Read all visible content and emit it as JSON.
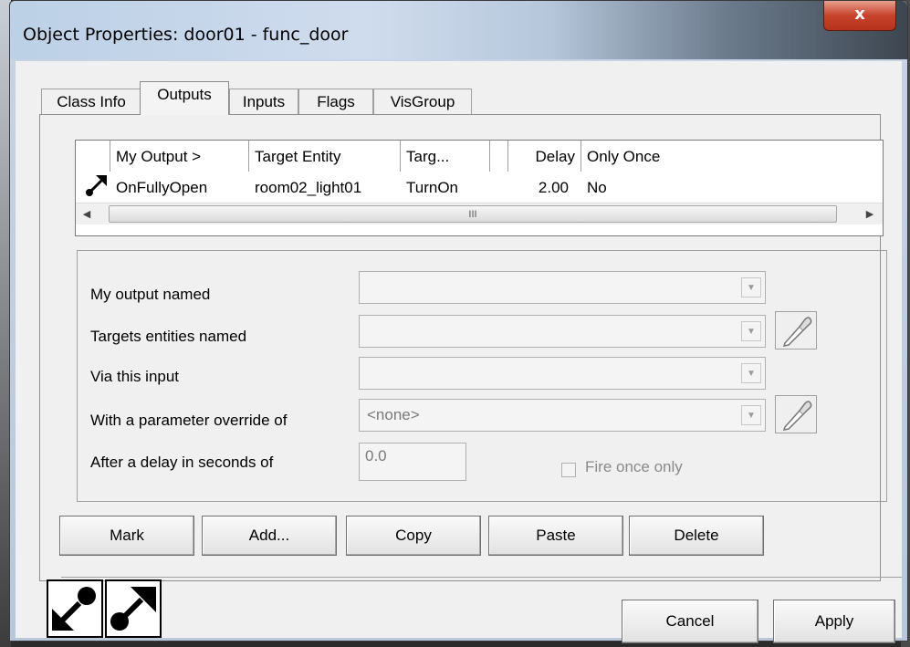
{
  "window": {
    "title": "Object Properties: door01 - func_door",
    "close_label": "x"
  },
  "tabs": [
    {
      "label": "Class Info",
      "active": false
    },
    {
      "label": "Outputs",
      "active": true
    },
    {
      "label": "Inputs",
      "active": false
    },
    {
      "label": "Flags",
      "active": false
    },
    {
      "label": "VisGroup",
      "active": false
    }
  ],
  "grid": {
    "columns": [
      "",
      "My Output  >",
      "Target Entity",
      "Targ...",
      "",
      "Delay",
      "Only Once"
    ],
    "rows": [
      {
        "icon": "output-arrow-icon",
        "output": "OnFullyOpen",
        "target": "room02_light01",
        "input": "TurnOn",
        "delay": "2.00",
        "only_once": "No"
      }
    ],
    "scroll_thumb": "III"
  },
  "editor": {
    "output_label": "My output named",
    "targets_label": "Targets entities named",
    "input_label": "Via this input",
    "param_label": "With a parameter override of",
    "param_value": "<none>",
    "delay_label": "After a delay in seconds of",
    "delay_value": "0.0",
    "fire_once_label": "Fire once only",
    "fire_once_checked": false
  },
  "buttons": {
    "mark": "Mark",
    "add": "Add...",
    "copy": "Copy",
    "paste": "Paste",
    "delete": "Delete",
    "cancel": "Cancel",
    "apply": "Apply"
  }
}
